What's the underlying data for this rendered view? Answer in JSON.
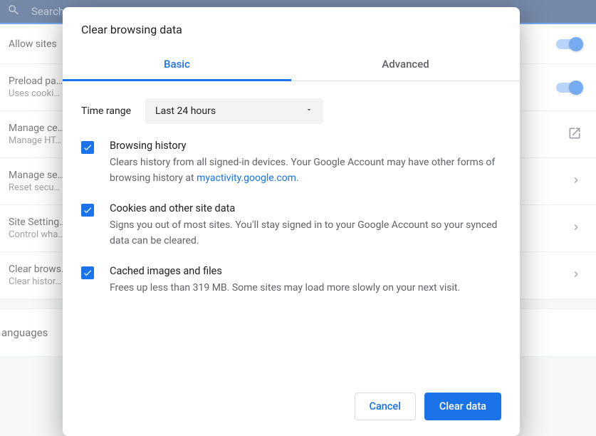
{
  "topbar": {
    "search_placeholder": "Search settings"
  },
  "rows": {
    "allow": {
      "title": "Allow sites"
    },
    "preload": {
      "title": "Preload pa…",
      "sub": "Uses cooki…"
    },
    "managece": {
      "title": "Manage ce…",
      "sub": "Manage HT…"
    },
    "managese": {
      "title": "Manage se…",
      "sub": "Reset secu…"
    },
    "site": {
      "title": "Site Setting…",
      "sub": "Control wha…"
    },
    "clear": {
      "title": "Clear brows…",
      "sub": "Clear histor…"
    }
  },
  "languages_label": "anguages",
  "dialog": {
    "title": "Clear browsing data",
    "tabs": {
      "basic": "Basic",
      "advanced": "Advanced"
    },
    "time_label": "Time range",
    "time_value": "Last 24 hours",
    "options": {
      "history": {
        "title": "Browsing history",
        "desc_before": "Clears history from all signed-in devices. Your Google Account may have other forms of browsing history at ",
        "link_text": "myactivity.google.com",
        "desc_after": "."
      },
      "cookies": {
        "title": "Cookies and other site data",
        "desc": "Signs you out of most sites. You'll stay signed in to your Google Account so your synced data can be cleared."
      },
      "cache": {
        "title": "Cached images and files",
        "desc": "Frees up less than 319 MB. Some sites may load more slowly on your next visit."
      }
    },
    "buttons": {
      "cancel": "Cancel",
      "clear": "Clear data"
    }
  }
}
